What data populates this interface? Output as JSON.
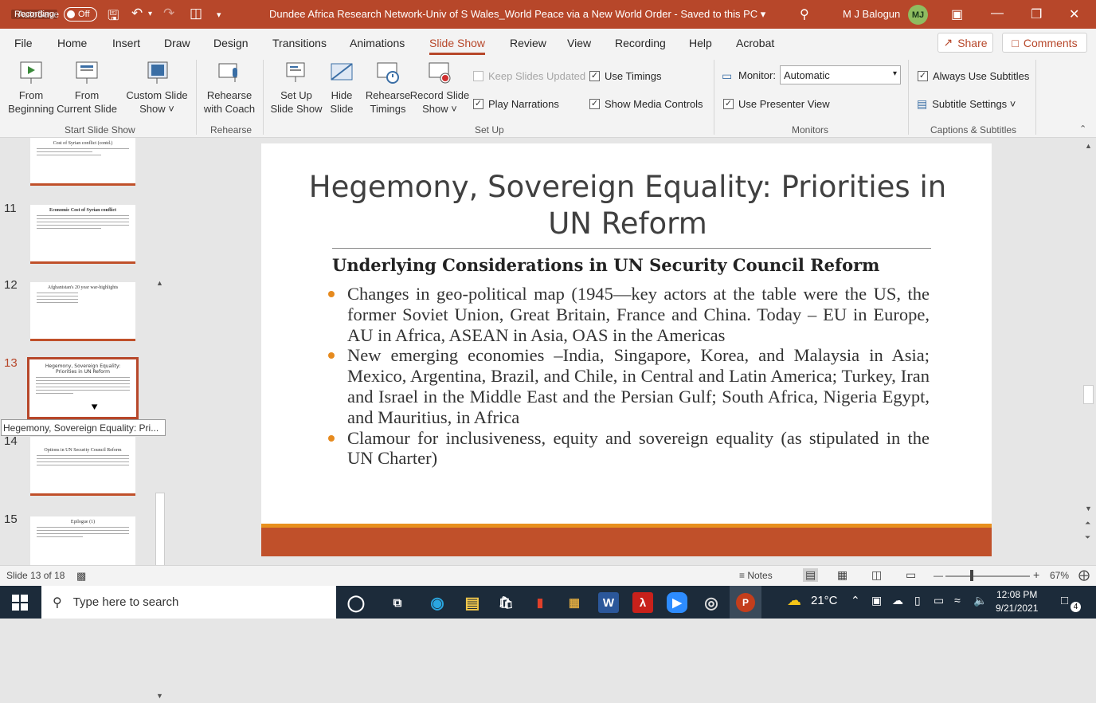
{
  "titlebar": {
    "recording": "Recording",
    "autosave_label": "AutoSave",
    "autosave_state": "Off",
    "doc_title": "Dundee Africa Research Network-Univ of S Wales_World Peace via a New World Order - Saved to this PC ▾",
    "user_name": "M J Balogun",
    "user_initials": "MJ"
  },
  "menu": {
    "items": [
      "File",
      "Home",
      "Insert",
      "Draw",
      "Design",
      "Transitions",
      "Animations",
      "Slide Show",
      "Review",
      "View",
      "Recording",
      "Help",
      "Acrobat"
    ],
    "active": "Slide Show",
    "share": "Share",
    "comments": "Comments"
  },
  "ribbon": {
    "from_beginning": [
      "From",
      "Beginning"
    ],
    "from_current": [
      "From",
      "Current Slide"
    ],
    "custom_show": [
      "Custom Slide",
      "Show ˅"
    ],
    "rehearse_coach": [
      "Rehearse",
      "with Coach"
    ],
    "setup_show": [
      "Set Up",
      "Slide Show"
    ],
    "hide_slide": [
      "Hide",
      "Slide"
    ],
    "rehearse_timings": [
      "Rehearse",
      "Timings"
    ],
    "record_show": [
      "Record Slide",
      "Show ˅"
    ],
    "keep_updated": "Keep Slides Updated",
    "use_timings": "Use Timings",
    "play_narrations": "Play Narrations",
    "show_media": "Show Media Controls",
    "monitor_label": "Monitor:",
    "monitor_value": "Automatic",
    "presenter_view": "Use Presenter View",
    "always_subtitles": "Always Use Subtitles",
    "subtitle_settings": "Subtitle Settings ˅",
    "groups": {
      "start": "Start Slide Show",
      "rehearse": "Rehearse",
      "setup": "Set Up",
      "monitors": "Monitors",
      "captions": "Captions & Subtitles"
    }
  },
  "thumbnails": {
    "items": [
      {
        "num": "",
        "title": "Cost of Syrian conflict (contd.)"
      },
      {
        "num": "11",
        "title": "Economic Cost of Syrian conflict"
      },
      {
        "num": "12",
        "title": "Afghanistan's 20 year war-highlights"
      },
      {
        "num": "13",
        "title": "Hegemony, Sovereign Equality: Priorities in UN Reform"
      },
      {
        "num": "14",
        "title": "Options in UN Security Council Reform"
      },
      {
        "num": "15",
        "title": "Epilogue (1)"
      }
    ],
    "tooltip": "Hegemony, Sovereign Equality: Pri..."
  },
  "slide": {
    "title": "Hegemony, Sovereign Equality: Priorities in UN Reform",
    "subtitle": "Underlying Considerations in UN Security Council Reform",
    "bullets": [
      "Changes in geo-political map (1945—key actors at the table were the US, the former Soviet Union, Great Britain, France and China. Today – EU in Europe, AU in Africa, ASEAN in Asia, OAS in the Americas",
      "New emerging economies –India, Singapore, Korea, and Malaysia in Asia; Mexico, Argentina, Brazil, and Chile, in Central and Latin America; Turkey, Iran and Israel in the Middle East and the Persian Gulf; South Africa, Nigeria Egypt, and Mauritius, in Africa",
      "Clamour for inclusiveness, equity and sovereign equality (as stipulated in the UN Charter)"
    ]
  },
  "status": {
    "slide_of": "Slide 13 of 18",
    "notes": "Notes",
    "zoom": "67%"
  },
  "taskbar": {
    "search_placeholder": "Type here to search",
    "weather": "21°C",
    "time": "12:08 PM",
    "date": "9/21/2021",
    "notifications": "4"
  },
  "colors": {
    "accent": "#b7472a",
    "bullet": "#e68a1e",
    "band": "#c0502a"
  }
}
